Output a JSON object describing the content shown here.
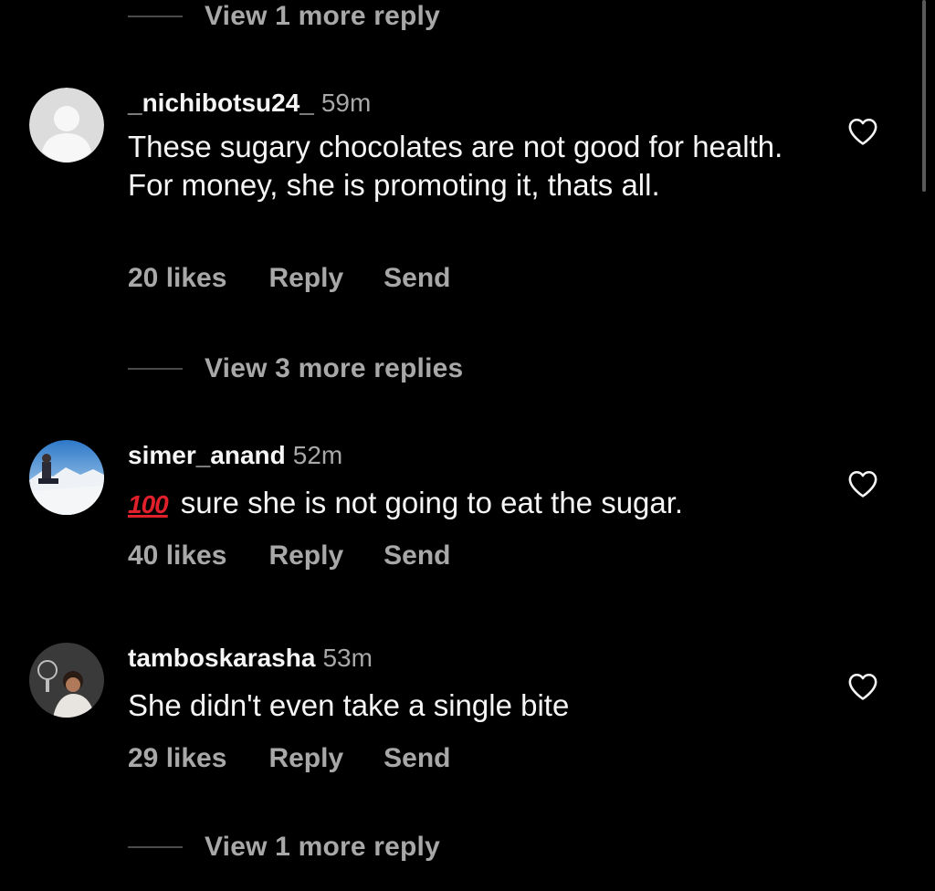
{
  "thread": {
    "top_view_replies": "View 1 more reply",
    "bottom_view_replies": "View 1 more reply",
    "middle_view_replies": "View 3 more replies"
  },
  "comments": [
    {
      "username": "_nichibotsu24_",
      "time": "59m",
      "text": "These sugary chocolates are not good for health. For money, she is promoting it, thats all.",
      "likes": "20 likes",
      "reply": "Reply",
      "send": "Send",
      "avatar": "default-avatar"
    },
    {
      "username": "simer_anand",
      "time": "52m",
      "emoji": "100",
      "text": "sure she is not going to eat the sugar.",
      "likes": "40 likes",
      "reply": "Reply",
      "send": "Send",
      "avatar": "photo-avatar-snow"
    },
    {
      "username": "tamboskarasha",
      "time": "53m",
      "text": "She didn't even take a single bite",
      "likes": "29 likes",
      "reply": "Reply",
      "send": "Send",
      "avatar": "photo-avatar-person"
    }
  ],
  "icons": {
    "like": "heart-outline-icon",
    "emoji": "hundred-points-emoji"
  },
  "colors": {
    "background": "#000000",
    "primary_text": "#f5f5f5",
    "secondary_text": "#a8a8a8",
    "emoji_red": "#e0202a"
  }
}
